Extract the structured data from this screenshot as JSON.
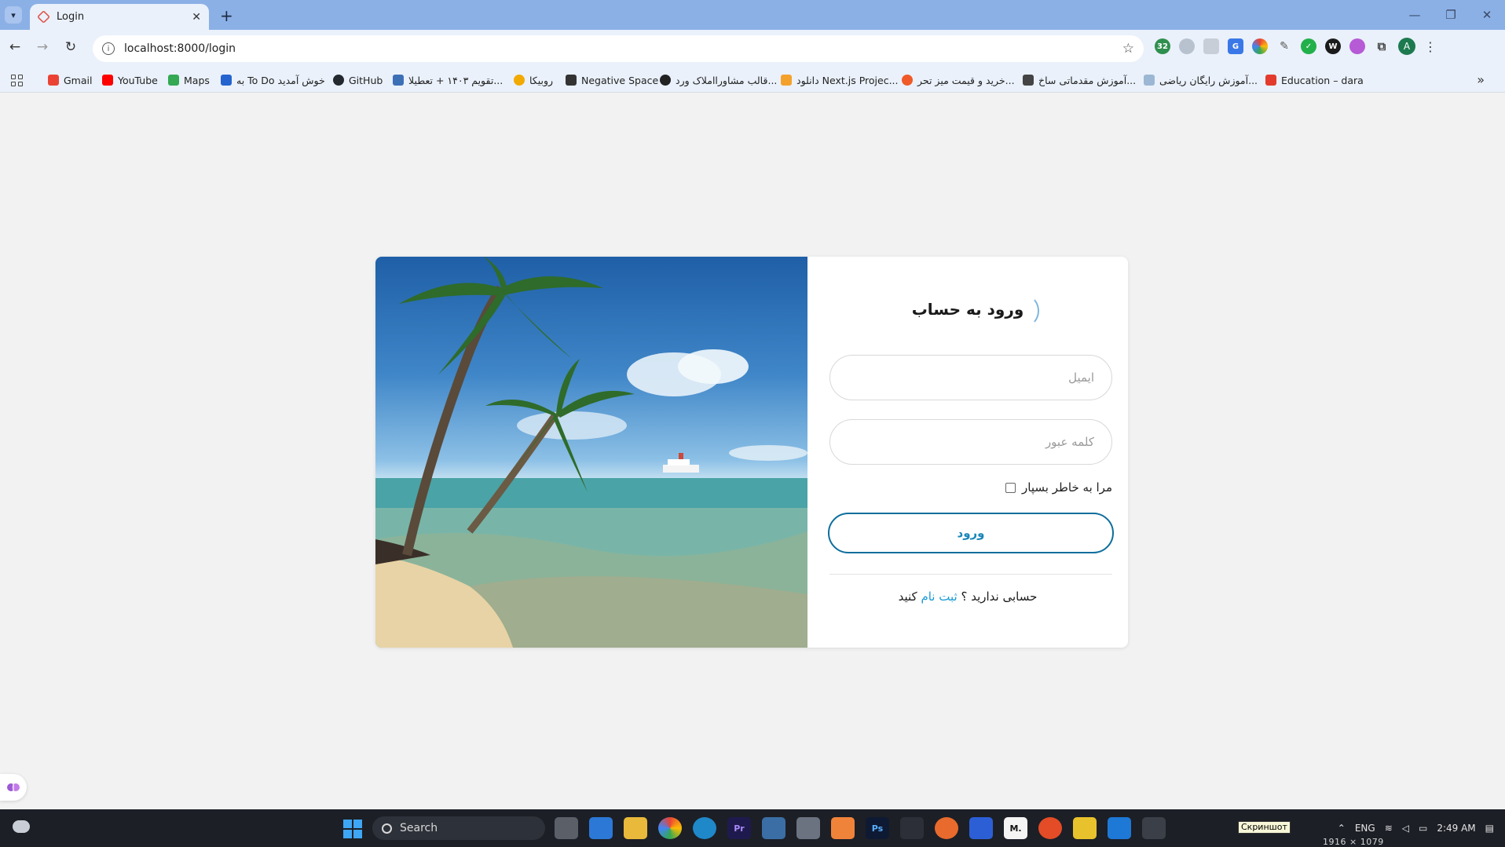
{
  "browser": {
    "tab_title": "Login",
    "url": "localhost:8000/login",
    "bookmarks": [
      {
        "label": "Gmail",
        "color": "#ea4335"
      },
      {
        "label": "YouTube",
        "color": "#ff0000"
      },
      {
        "label": "Maps",
        "color": "#34a853"
      },
      {
        "label": "به To Do خوش آمدید",
        "color": "#2564cf"
      },
      {
        "label": "GitHub",
        "color": "#24292f"
      },
      {
        "label": "تقویم ۱۴۰۳ + تعطیلا...",
        "color": "#3d6fb6"
      },
      {
        "label": "روبیکا",
        "color": "#f2a900"
      },
      {
        "label": "Negative Space",
        "color": "#333333"
      },
      {
        "label": "قالب مشاورااملاک ورد...",
        "color": "#222222"
      },
      {
        "label": "دانلود Next.js Projec...",
        "color": "#f4a12c"
      },
      {
        "label": "خرید و قیمت میز تحر...",
        "color": "#f05a28"
      },
      {
        "label": "آموزش مقدماتی ساخ...",
        "color": "#444444"
      },
      {
        "label": "آموزش رایگان ریاضی...",
        "color": "#9bb7d4"
      },
      {
        "label": "Education – dara",
        "color": "#e23b2e"
      }
    ]
  },
  "login": {
    "title": "ورود به حساب",
    "email_placeholder": "ایمیل",
    "password_placeholder": "کلمه عبور",
    "remember_label": "مرا به خاطر بسپار",
    "submit_label": "ورود",
    "signup_prefix": "حسابی ندارید ؟",
    "signup_link": "ثبت نام",
    "signup_suffix": "کنید"
  },
  "taskbar": {
    "search_label": "Search",
    "language": "ENG",
    "time": "2:49 AM",
    "screenshot_label": "Скриншот",
    "screenshot_dims": "1916 × 1079"
  },
  "colors": {
    "accent": "#1a86b8",
    "link": "#1a9ad6",
    "button_border": "#0d6e9c"
  }
}
